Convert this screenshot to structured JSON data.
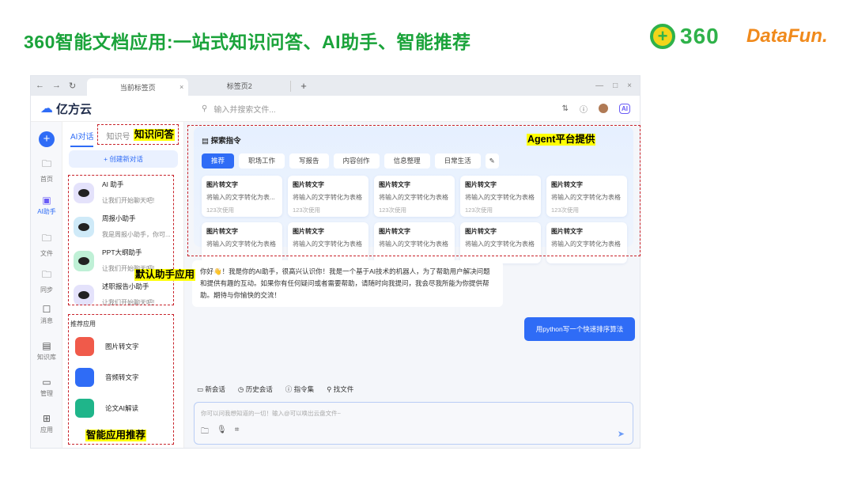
{
  "slide": {
    "title": "360智能文档应用:一站式知识问答、AI助手、智能推荐",
    "logo_360": "360",
    "logo_datafun": "DataFun."
  },
  "browser": {
    "tabs": [
      "当前标签页",
      "标签页2"
    ],
    "new_tab": "+",
    "close": "×",
    "controls": [
      "—",
      "□",
      "×"
    ],
    "nav": [
      "←",
      "→",
      "↻"
    ]
  },
  "header": {
    "brand": "亿方云",
    "search_placeholder": "输入并搜索文件...",
    "ai_badge": "AI"
  },
  "leftnav": {
    "items": [
      {
        "label": "首页",
        "icon": "home-folder-icon"
      },
      {
        "label": "AI助手",
        "icon": "ai-icon"
      },
      {
        "label": "文件",
        "icon": "file-folder-icon"
      },
      {
        "label": "同步",
        "icon": "sync-folder-icon"
      },
      {
        "label": "消息",
        "icon": "message-icon"
      },
      {
        "label": "知识库",
        "icon": "knowledge-icon"
      },
      {
        "label": "管理",
        "icon": "monitor-icon"
      },
      {
        "label": "应用",
        "icon": "grid-icon"
      }
    ]
  },
  "panel": {
    "tabs": [
      "AI对话",
      "知识号"
    ],
    "new_chat": "+  创建新对话",
    "assistants": [
      {
        "name": "AI 助手",
        "desc": "让我们开始聊天吧!"
      },
      {
        "name": "周报小助手",
        "desc": "我是周报小助手，你可..."
      },
      {
        "name": "PPT大纲助手",
        "desc": "让我们开始聊天吧!"
      },
      {
        "name": "述职报告小助手",
        "desc": "让我们开始聊天吧!"
      }
    ],
    "rec_header": "推荐应用",
    "apps": [
      "图片转文字",
      "音频转文字",
      "论文AI解读"
    ]
  },
  "explore": {
    "title": "探索指令",
    "chips": [
      "推荐",
      "职场工作",
      "写报告",
      "内容创作",
      "信息整理",
      "日常生活"
    ],
    "cards": [
      {
        "title": "图片转文字",
        "desc": "将输入的文字转化为表...",
        "usage": "123次使用"
      },
      {
        "title": "图片转文字",
        "desc": "将输入的文字转化为表格",
        "usage": "123次使用"
      },
      {
        "title": "图片转文字",
        "desc": "将输入的文字转化为表格",
        "usage": "123次使用"
      },
      {
        "title": "图片转文字",
        "desc": "将输入的文字转化为表格",
        "usage": "123次使用"
      },
      {
        "title": "图片转文字",
        "desc": "将输入的文字转化为表格",
        "usage": "123次使用"
      },
      {
        "title": "图片转文字",
        "desc": "将输入的文字转化为表格",
        "usage": ""
      },
      {
        "title": "图片转文字",
        "desc": "将输入的文字转化为表格",
        "usage": ""
      },
      {
        "title": "图片转文字",
        "desc": "将输入的文字转化为表格",
        "usage": ""
      },
      {
        "title": "图片转文字",
        "desc": "将输入的文字转化为表格",
        "usage": ""
      },
      {
        "title": "图片转文字",
        "desc": "将输入的文字转化为表格",
        "usage": ""
      }
    ]
  },
  "chat": {
    "bot_message": "你好👋！我是你的AI助手，很高兴认识你！我是一个基于AI技术的机器人，为了帮助用户解决问题和提供有趣的互动。如果你有任何疑问或者需要帮助，请随时向我提问，我会尽我所能为你提供帮助。期待与你愉快的交流！",
    "user_message": "用python写一个快速排序算法",
    "tools": [
      "新会话",
      "历史会话",
      "指令集",
      "找文件"
    ],
    "input_placeholder": "你可以问我想知道的一切！输入@可以唤出云盘文件~"
  },
  "annotations": [
    "知识问答",
    "Agent平台提供",
    "默认助手应用",
    "智能应用推荐"
  ]
}
